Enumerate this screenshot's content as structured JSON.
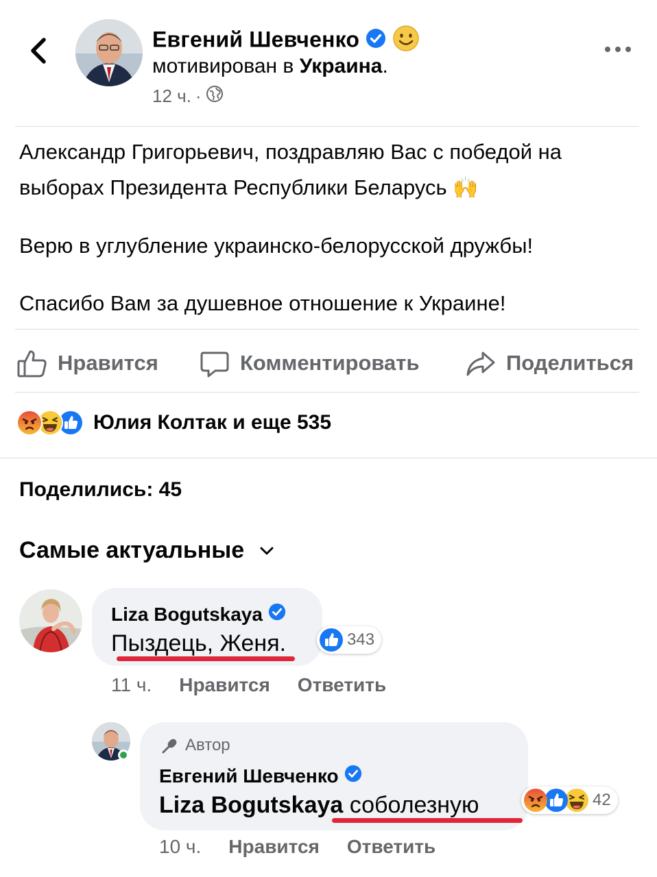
{
  "header": {
    "author_name": "Евгений Шевченко",
    "status_prefix": "мотивирован в ",
    "status_place": "Украина",
    "status_suffix": ".",
    "time": "12 ч.",
    "separator": "·",
    "feeling_icon": "smiling-face-icon",
    "privacy_icon": "globe-icon",
    "back_icon": "chevron-left-icon",
    "more_icon": "ellipsis-icon"
  },
  "post": {
    "line1": "Александр Григорьевич, поздравляю Вас с победой на",
    "line2": "выборах Президента Республики Беларусь",
    "line2_emoji": "🙌",
    "para2": "Верю в углубление украинско-белорусской дружбы!",
    "para3": "Спасибо Вам за душевное отношение к Украине!"
  },
  "actions": {
    "like": "Нравится",
    "comment": "Комментировать",
    "share": "Поделиться"
  },
  "reactions": {
    "icons": [
      "angry-reaction-icon",
      "haha-reaction-icon",
      "like-reaction-icon"
    ],
    "summary": "Юлия Колтак и еще 535"
  },
  "shares": "Поделились: 45",
  "sort": {
    "label": "Самые актуальные",
    "icon": "chevron-down-icon"
  },
  "comments": [
    {
      "name": "Liza Bogutskaya",
      "text": "Пыздець, Женя.",
      "reactions_count": "343",
      "time": "11 ч.",
      "like": "Нравится",
      "reply": "Ответить"
    },
    {
      "badge": "Автор",
      "name": "Евгений Шевченко",
      "mention": "Liza Bogutskaya",
      "text": "соболезную",
      "reactions_count": "42",
      "time": "10 ч.",
      "like": "Нравится",
      "reply": "Ответить"
    }
  ],
  "colors": {
    "facebook_blue": "#1877f2",
    "secondary_text": "#65676b",
    "bubble_bg": "#f0f2f5",
    "underline_red": "#e0263a"
  }
}
